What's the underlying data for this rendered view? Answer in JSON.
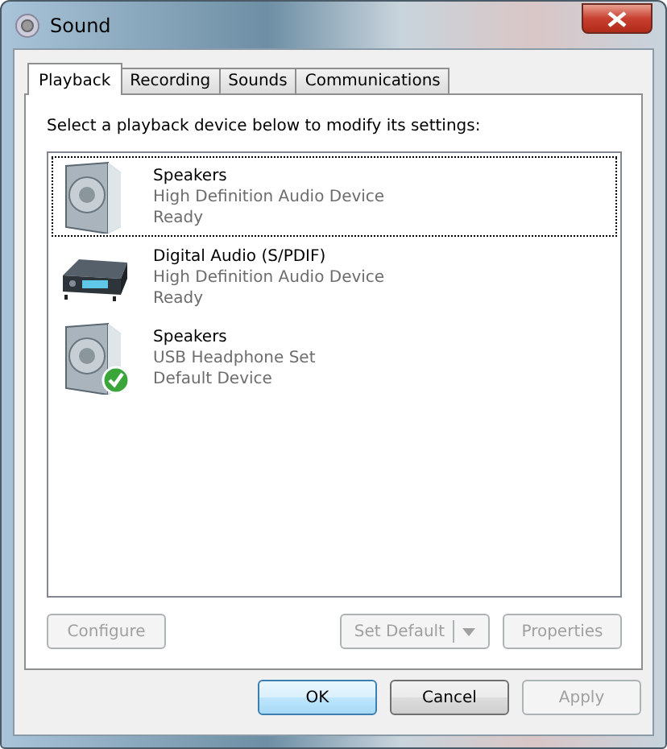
{
  "window": {
    "title": "Sound"
  },
  "tabs": [
    {
      "label": "Playback",
      "selected": true
    },
    {
      "label": "Recording",
      "selected": false
    },
    {
      "label": "Sounds",
      "selected": false
    },
    {
      "label": "Communications",
      "selected": false
    }
  ],
  "instruction": "Select a playback device below to modify its settings:",
  "devices": [
    {
      "kind": "speaker",
      "name": "Speakers",
      "description": "High Definition Audio Device",
      "status": "Ready",
      "selected": true,
      "default": false
    },
    {
      "kind": "receiver",
      "name": "Digital Audio (S/PDIF)",
      "description": "High Definition Audio Device",
      "status": "Ready",
      "selected": false,
      "default": false
    },
    {
      "kind": "speaker",
      "name": "Speakers",
      "description": "USB Headphone Set",
      "status": "Default Device",
      "selected": false,
      "default": true
    }
  ],
  "device_buttons": [
    {
      "label": "Configure",
      "disabled": true
    },
    {
      "label": "Set Default",
      "disabled": true,
      "dropdown": true
    },
    {
      "label": "Properties",
      "disabled": true
    }
  ],
  "dialog_buttons": [
    {
      "label": "OK",
      "disabled": false,
      "default": true
    },
    {
      "label": "Cancel",
      "disabled": false,
      "default": false
    },
    {
      "label": "Apply",
      "disabled": true,
      "default": false
    }
  ]
}
